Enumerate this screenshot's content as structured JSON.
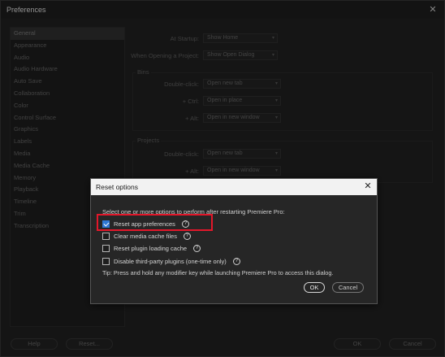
{
  "window": {
    "title": "Preferences",
    "close": "✕"
  },
  "sidebar": {
    "items": [
      "General",
      "Appearance",
      "Audio",
      "Audio Hardware",
      "Auto Save",
      "Collaboration",
      "Color",
      "Control Surface",
      "Graphics",
      "Labels",
      "Media",
      "Media Cache",
      "Memory",
      "Playback",
      "Timeline",
      "Trim",
      "Transcription"
    ],
    "selected": "General"
  },
  "general": {
    "at_startup_label": "At Startup:",
    "at_startup_value": "Show Home",
    "opening_project_label": "When Opening a Project:",
    "opening_project_value": "Show Open Dialog",
    "bins": {
      "title": "Bins",
      "double_click_label": "Double-click:",
      "double_click_value": "Open new tab",
      "ctrl_label": "+ Ctrl:",
      "ctrl_value": "Open in place",
      "alt_label": "+ Alt:",
      "alt_value": "Open in new window"
    },
    "projects": {
      "title": "Projects",
      "double_click_label": "Double-click:",
      "double_click_value": "Open new tab",
      "alt_label": "+ Alt:",
      "alt_value": "Open in new window"
    }
  },
  "footer": {
    "help": "Help",
    "reset": "Reset...",
    "ok": "OK",
    "cancel": "Cancel"
  },
  "dialog": {
    "title": "Reset options",
    "close": "✕",
    "intro": "Select one or more options to perform after restarting Premiere Pro:",
    "options": [
      {
        "label": "Reset app preferences",
        "checked": true
      },
      {
        "label": "Clear media cache files",
        "checked": false
      },
      {
        "label": "Reset plugin loading cache",
        "checked": false
      },
      {
        "label": "Disable third-party plugins (one-time only)",
        "checked": false
      }
    ],
    "help_glyph": "?",
    "tip": "Tip: Press and hold any modifier key while launching Premiere Pro to access this dialog.",
    "ok": "OK",
    "cancel": "Cancel"
  },
  "colors": {
    "accent": "#2e78d6",
    "highlight": "#e3172a"
  }
}
